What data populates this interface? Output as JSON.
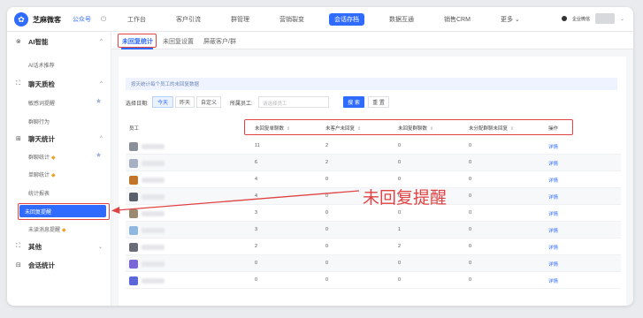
{
  "app": {
    "title": "芝麻微客",
    "subtitle": "公众号",
    "logo_icon": "sesame-logo-icon"
  },
  "topnav": {
    "tabs": [
      "工作台",
      "客户引流",
      "群管理",
      "营销裂变",
      "会话存档",
      "数据互通",
      "销售CRM",
      "更多 ⌄"
    ],
    "active_index": 4,
    "user_name": "企业微信",
    "accent_color": "#2f6bff"
  },
  "sidebar": {
    "groups": [
      {
        "label": "AI智能",
        "icon": "⊗",
        "items": [
          {
            "label": "AI话术推荐"
          }
        ]
      },
      {
        "label": "聊天质检",
        "icon": "[×]",
        "items": [
          {
            "label": "敏感词提醒",
            "star": true
          },
          {
            "label": "群聊行为"
          }
        ]
      },
      {
        "label": "聊天统计",
        "icon": "[≡]",
        "items": [
          {
            "label": "群聊统计",
            "badge": true,
            "star": true
          },
          {
            "label": "单聊统计",
            "badge": true
          },
          {
            "label": "统计报表"
          }
        ]
      },
      {
        "label": "其他",
        "icon": "[×]",
        "items": []
      },
      {
        "label": "会话统计",
        "icon": "⊟",
        "items": []
      }
    ],
    "active_item": "未回复提醒",
    "extra_item": "未读消息提醒"
  },
  "subtabs": {
    "items": [
      "未回复统计",
      "未回复设置",
      "屏蔽客户/群"
    ],
    "active_index": 0
  },
  "info": {
    "text": "按天统计每个员工的未回复数据"
  },
  "filter": {
    "date_label": "选择日期:",
    "date_options": [
      "今天",
      "昨天",
      "自定义"
    ],
    "date_active": "今天",
    "staff_label": "所属员工:",
    "staff_placeholder": "请选择员工",
    "search_label": "搜 索",
    "reset_label": "重 置"
  },
  "table": {
    "columns": [
      "员工",
      "未回复单聊数",
      "未客户未回复",
      "未回复群聊数",
      "未分配群聊未回复",
      "操作"
    ],
    "rows": [
      {
        "c1": "11",
        "c2": "2",
        "c3": "0",
        "c4": "0",
        "action": "详情",
        "avatar_color": "#8a8f99"
      },
      {
        "c1": "6",
        "c2": "2",
        "c3": "0",
        "c4": "0",
        "action": "详情",
        "avatar_color": "#a7b0c2"
      },
      {
        "c1": "4",
        "c2": "0",
        "c3": "0",
        "c4": "0",
        "action": "详情",
        "avatar_color": "#c0742c"
      },
      {
        "c1": "4",
        "c2": "0",
        "c3": "0",
        "c4": "0",
        "action": "详情",
        "avatar_color": "#5a5f6a"
      },
      {
        "c1": "3",
        "c2": "0",
        "c3": "0",
        "c4": "0",
        "action": "详情",
        "avatar_color": "#9a8a70"
      },
      {
        "c1": "3",
        "c2": "0",
        "c3": "1",
        "c4": "0",
        "action": "详情",
        "avatar_color": "#8fb7e0"
      },
      {
        "c1": "2",
        "c2": "0",
        "c3": "2",
        "c4": "0",
        "action": "详情",
        "avatar_color": "#6a6d75"
      },
      {
        "c1": "0",
        "c2": "0",
        "c3": "0",
        "c4": "0",
        "action": "详情",
        "avatar_color": "#7a66d6"
      },
      {
        "c1": "0",
        "c2": "0",
        "c3": "0",
        "c4": "0",
        "action": "详情",
        "avatar_color": "#5a67d8"
      }
    ]
  },
  "callout": {
    "text": "未回复提醒",
    "color": "#e04343"
  }
}
